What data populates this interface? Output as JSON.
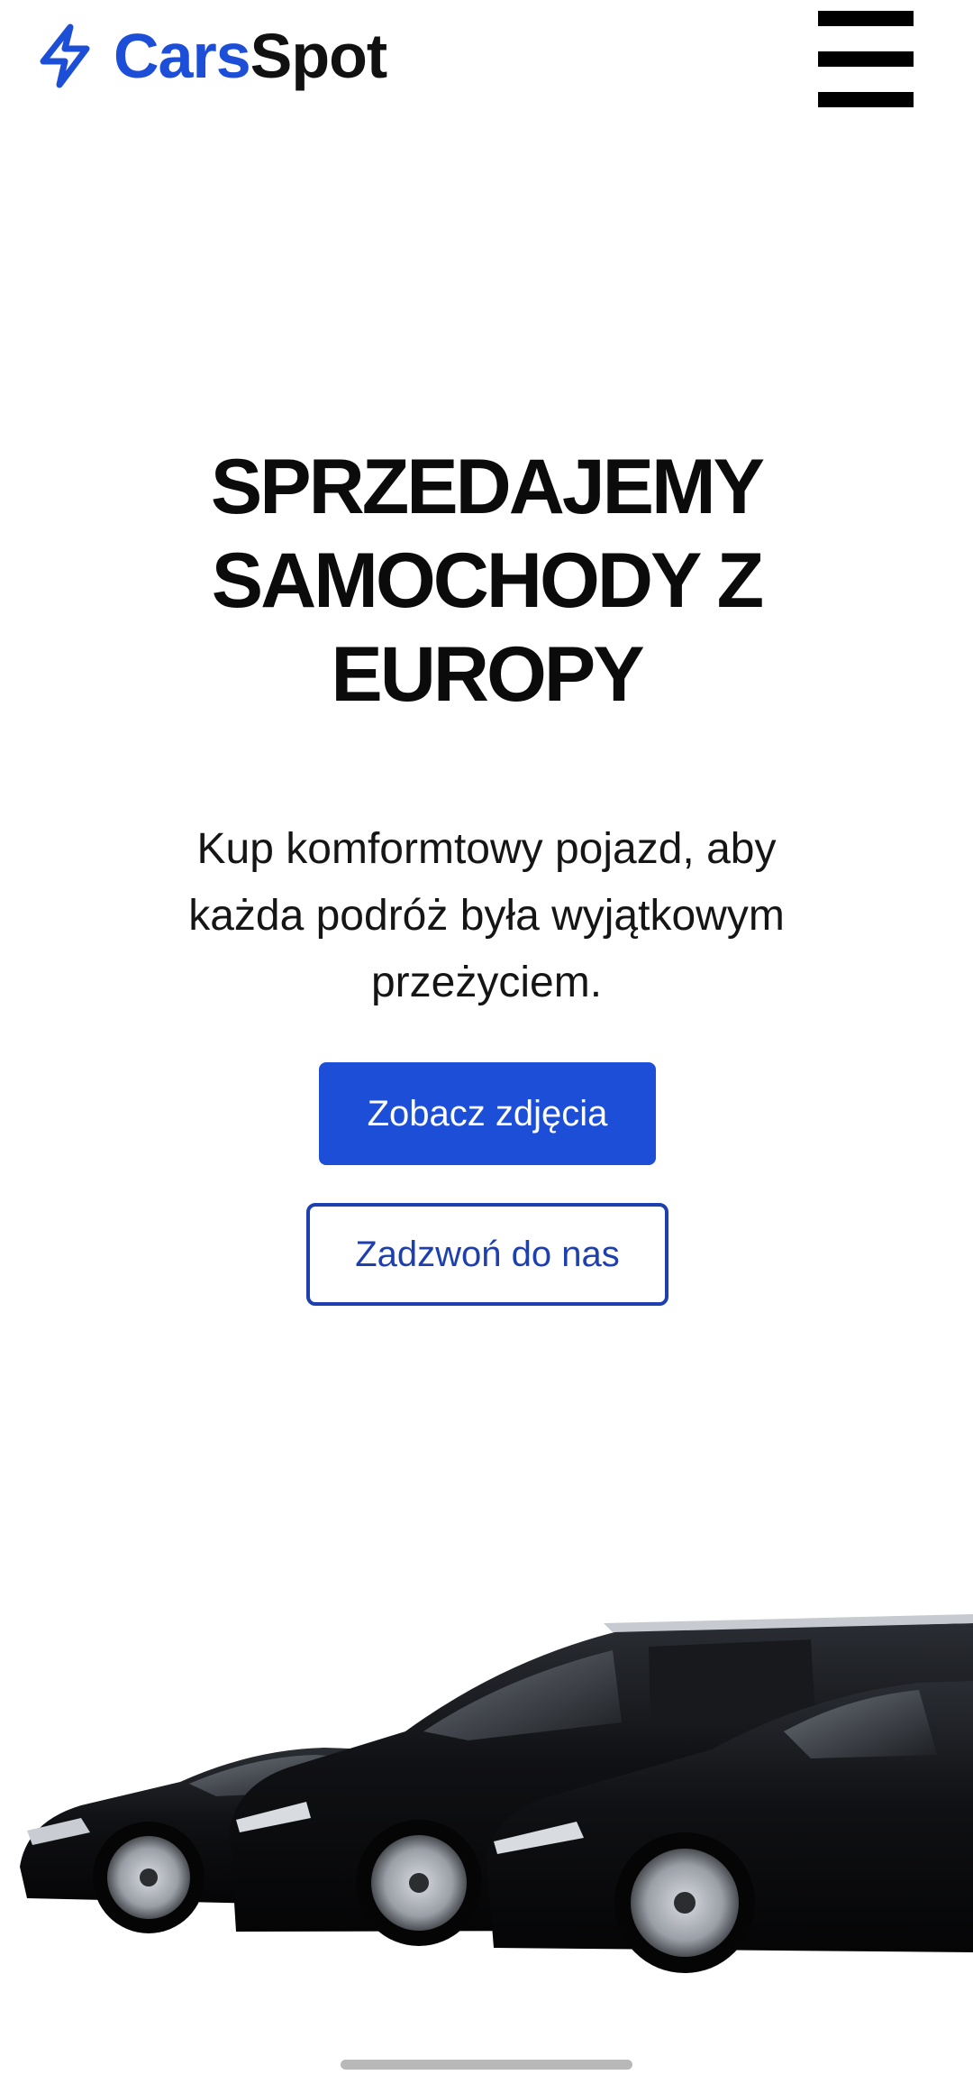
{
  "header": {
    "logo_part1": "Cars",
    "logo_part2": "Spot",
    "logo_icon": "lightning-bolt-icon",
    "menu_icon": "hamburger-menu-icon"
  },
  "hero": {
    "title_line1": "SPRZEDAJEMY",
    "title_line2": "SAMOCHODY Z",
    "title_line3": "EUROPY",
    "subtitle_line1": "Kup komformtowy pojazd, aby",
    "subtitle_line2": "każda podróż była wyjątkowym",
    "subtitle_line3": "przeżyciem.",
    "primary_button": "Zobacz zdjęcia",
    "secondary_button": "Zadzwoń do nas"
  },
  "colors": {
    "accent": "#1d4ed8",
    "outline": "#1e40af",
    "text": "#111111",
    "background": "#ffffff"
  }
}
